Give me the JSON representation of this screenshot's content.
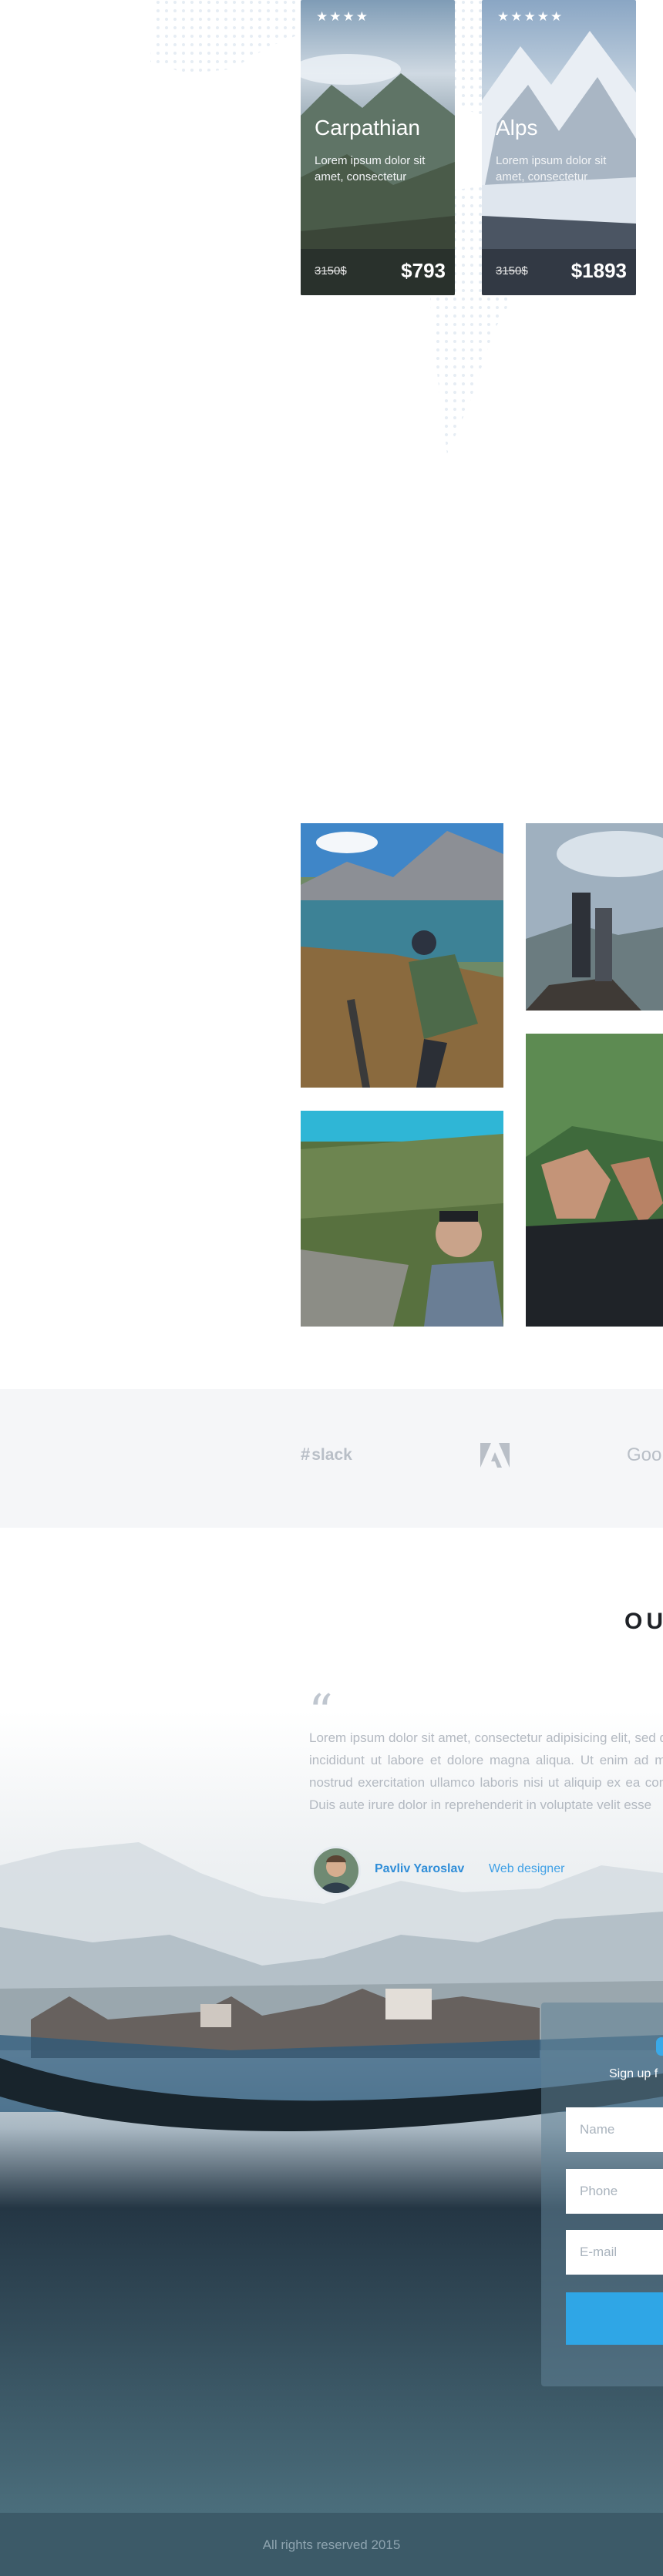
{
  "tours": [
    {
      "stars": "★★★★",
      "title": "Carpathian",
      "description": "Lorem ipsum dolor sit amet, consectetur",
      "old_price": "3150$",
      "price": "$793"
    },
    {
      "stars": "★★★★★",
      "title": "Alps",
      "description": "Lorem ipsum dolor sit amet, consectetur",
      "old_price": "3150$",
      "price": "$1893"
    }
  ],
  "partners": {
    "slack": "slack",
    "google": "Goo"
  },
  "testimonials": {
    "section_title": "OU",
    "quote": "Lorem ipsum dolor sit amet, consectetur adipisicing elit, sed do eiusmod tempor incididunt ut labore et dolore magna aliqua. Ut enim ad minim veniam, quis nostrud exercitation ullamco laboris nisi ut aliquip ex ea commodo consequat. Duis aute irure dolor in reprehenderit in voluptate velit esse",
    "author_name": "Pavliv Yaroslav",
    "author_role": "Web designer"
  },
  "signup": {
    "subtitle": "Sign up f",
    "name_placeholder": "Name",
    "phone_placeholder": "Phone",
    "email_placeholder": "E-mail"
  },
  "footer": {
    "copyright": "All rights reserved 2015"
  },
  "colors": {
    "accent": "#2fa6e6",
    "author": "#2f8dd8",
    "footer": "#3c5a68",
    "partners_bg": "#f5f6f8"
  },
  "icons": {
    "star": "star-icon",
    "quote": "quote-icon",
    "slack": "slack-logo",
    "adobe": "adobe-logo"
  }
}
